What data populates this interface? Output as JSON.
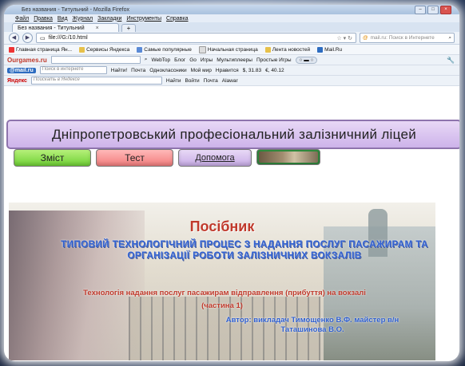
{
  "window": {
    "title": "Без названия - Титульний - Mozilla Firefox",
    "controls": [
      "–",
      "□",
      "×"
    ]
  },
  "menu": [
    "Файл",
    "Правка",
    "Вид",
    "Журнал",
    "Закладки",
    "Инструменты",
    "Справка"
  ],
  "tab": {
    "label": "Без названия - Титульний",
    "close": "×",
    "new_tab": "+"
  },
  "nav": {
    "url": "file:///G:/10.html",
    "search_placeholder": "mail.ru: Поиск в Интернете"
  },
  "bookmarks": [
    "Главная страница Ян...",
    "Сервисы Яндекса",
    "Самые популярные",
    "Начальная страница",
    "Лента новостей",
    "Mail.Ru"
  ],
  "toolbar1": {
    "brand": "Ourgames.ru",
    "webtop": "WebTop",
    "blog": "Блог",
    "go": "Go",
    "games": "Игры",
    "multiplayer": "Мультиплееры",
    "simple_games": "Простые Игры"
  },
  "toolbar2": {
    "brand": "@mail.ru",
    "search_placeholder": "Поиск в интернете",
    "find": "Найти!",
    "mail": "Почта",
    "odnoklassniki": "Одноклассники",
    "my_world": "Мой мир",
    "like": "Нравится",
    "usd": "$, 31.83",
    "eur": "€, 40.12"
  },
  "toolbar3": {
    "brand": "Яндекс",
    "search_placeholder": "Поискать в Яндексе",
    "find": "Найти",
    "login": "Войти",
    "mail": "Почта",
    "alawar": "Alawar"
  },
  "page": {
    "banner": "Дніпропетровський професіональний залізничний ліцей",
    "nav_buttons": [
      "Зміст",
      "Тест",
      "Допомога"
    ],
    "illustration": {
      "title": "Посібник",
      "subtitle": "Типовий технологічний процес з надання послуг пасажирам та організації роботи залізничних вокзалів",
      "red_line": "Технологія надання послуг пасажирам відправлення (прибуття) на вокзалі",
      "part": "(частина 1)",
      "authors": "Автор: викладач Тимощенко В.Ф. майстер в/н Таташинова В.О."
    }
  },
  "colors": {
    "banner_bg": "#cdb3ea",
    "btn_contents": "#6fd135",
    "btn_test": "#f27d7d",
    "btn_help": "#c8ace6",
    "title_red": "#c0392b",
    "subtitle_blue": "#2f5fd0"
  }
}
